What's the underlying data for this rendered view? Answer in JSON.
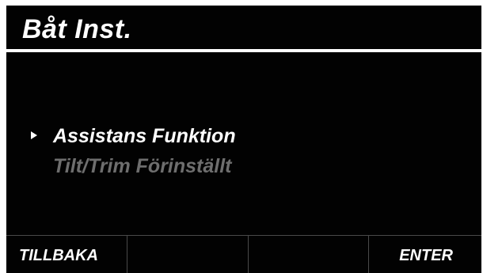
{
  "header": {
    "title": "Båt Inst."
  },
  "menu": {
    "items": [
      {
        "label": "Assistans Funktion",
        "state": "selected"
      },
      {
        "label": "Tilt/Trim Förinställt",
        "state": "disabled"
      }
    ]
  },
  "softkeys": [
    {
      "label": "TILLBAKA"
    },
    {
      "label": ""
    },
    {
      "label": ""
    },
    {
      "label": "ENTER"
    }
  ],
  "colors": {
    "background": "#020202",
    "text": "#ffffff",
    "disabled_text": "#6e6e6e",
    "divider": "#4a4a4a"
  }
}
